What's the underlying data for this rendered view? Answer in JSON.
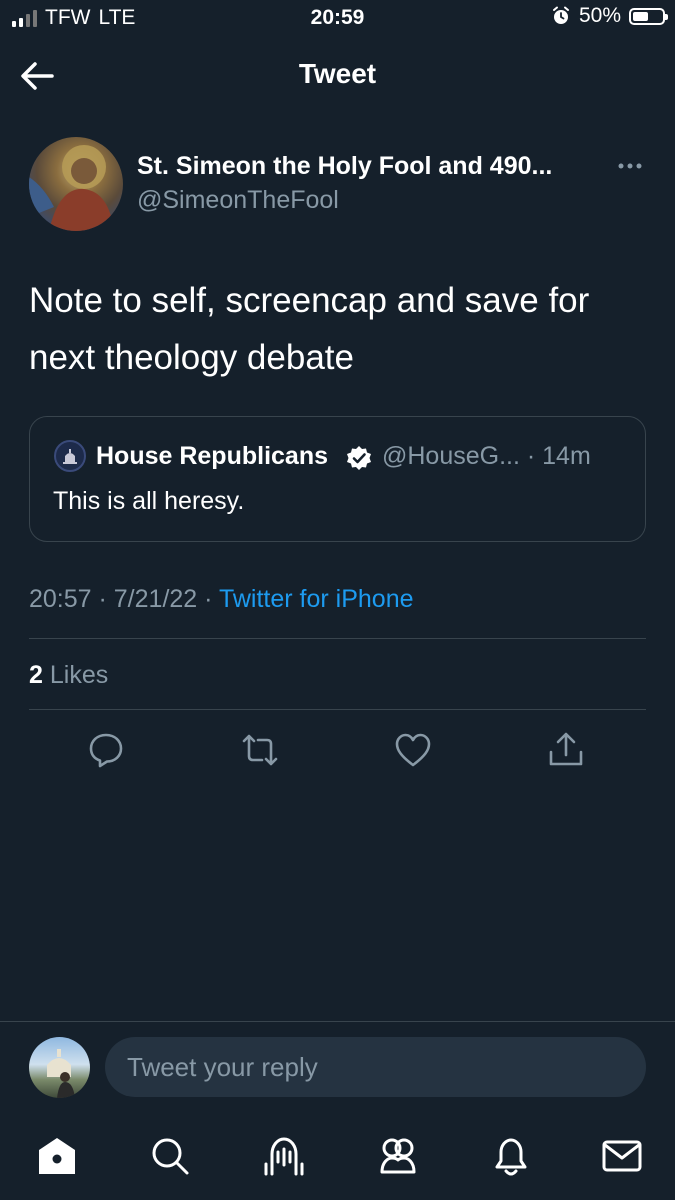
{
  "status_bar": {
    "carrier": "TFW",
    "network": "LTE",
    "time": "20:59",
    "battery_percent": "50%",
    "battery_level": 0.5
  },
  "header": {
    "title": "Tweet"
  },
  "tweet": {
    "display_name": "St. Simeon the Holy Fool and 490...",
    "handle": "@SimeonTheFool",
    "text": "Note to self, screencap and save for next theology debate",
    "time": "20:57",
    "date": "7/21/22",
    "source": "Twitter for iPhone",
    "likes_count": "2",
    "likes_label": "Likes"
  },
  "quoted_tweet": {
    "name": "House Republicans",
    "handle": "@HouseG...",
    "age": "14m",
    "text": "This is all heresy."
  },
  "reply": {
    "placeholder": "Tweet your reply"
  },
  "colors": {
    "background": "#15202b",
    "secondary_text": "#8899a6",
    "accent": "#1d9bf0",
    "divider": "#38444d"
  }
}
